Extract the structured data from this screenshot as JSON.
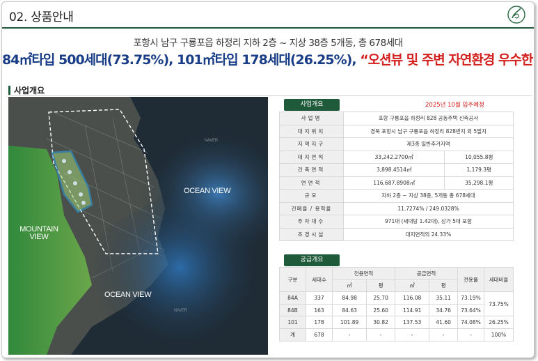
{
  "header": {
    "title": "02. 상품안내",
    "logo_icon": "brand-circle-logo-icon"
  },
  "headline": {
    "sub": "포항시 남구 구룡포읍 하정리 지하 2층 ~ 지상 38층 5개동, 총 678세대",
    "main_blue": "84㎡타입 500세대(73.75%), 101㎡타입 178세대(26.25%),",
    "main_red": "“오션뷰 및 주변 자연환경 우수한 입지”"
  },
  "section": {
    "title": "사업개요"
  },
  "map": {
    "ocean_view_1": "OCEAN VIEW",
    "ocean_view_2": "OCEAN VIEW",
    "mountain_view": "MOUNTAIN VIEW",
    "watermark_1": "NAVER",
    "watermark_2": "NAVER"
  },
  "overview": {
    "badge": "사업개요",
    "move_in": "2025년 10월 입주예정",
    "rows": [
      {
        "label": "사업명",
        "value": "포항 구룡포읍 하정리 828 공동주택 신축공사"
      },
      {
        "label": "대지위치",
        "value": "경북 포항시 남구 구룡포읍 하정리 828번지 외 5필지"
      },
      {
        "label": "지역지구",
        "value": "제3종 일반주거지역"
      },
      {
        "label": "대지면적",
        "value_a": "33,242.2700㎡",
        "value_b": "10,055.8평"
      },
      {
        "label": "건축면적",
        "value_a": "3,898.4514㎡",
        "value_b": "1,179.3평"
      },
      {
        "label": "연면적",
        "value_a": "116,687.8908㎡",
        "value_b": "35,298.1평"
      },
      {
        "label": "규모",
        "value": "지하 2층 ~ 지상 38층, 5개동 총 678세대"
      },
      {
        "label": "건폐율 / 용적율",
        "value": "11.7274% / 249.0328%"
      },
      {
        "label": "주차대수",
        "value": "971대 (세대당 1.42대), 상가 5대 포함"
      },
      {
        "label": "조경시설",
        "value": "대지면적의 24.33%"
      }
    ]
  },
  "supply": {
    "badge": "공급개요",
    "headers": {
      "type": "구분",
      "households": "세대수",
      "exclusive": "전용면적",
      "supply": "공급면적",
      "ratio": "전용률",
      "share": "세대비율",
      "sqm": "㎡",
      "pyeong": "평"
    },
    "rows": [
      {
        "type": "84A",
        "households": "337",
        "ex_sqm": "84.98",
        "ex_py": "25.70",
        "sup_sqm": "116.08",
        "sup_py": "35.11",
        "ratio": "73.19%"
      },
      {
        "type": "84B",
        "households": "163",
        "ex_sqm": "84.63",
        "ex_py": "25.60",
        "sup_sqm": "114.91",
        "sup_py": "34.76",
        "ratio": "73.64%"
      },
      {
        "type": "101",
        "households": "178",
        "ex_sqm": "101.89",
        "ex_py": "30.82",
        "sup_sqm": "137.53",
        "sup_py": "41.60",
        "ratio": "74.08%",
        "share": "26.25%"
      },
      {
        "type": "계",
        "households": "678",
        "ex_sqm": "-",
        "ex_py": "-",
        "sup_sqm": "-",
        "sup_py": "-",
        "ratio": "-",
        "share": "100%"
      }
    ],
    "share_84": "73.75%"
  }
}
